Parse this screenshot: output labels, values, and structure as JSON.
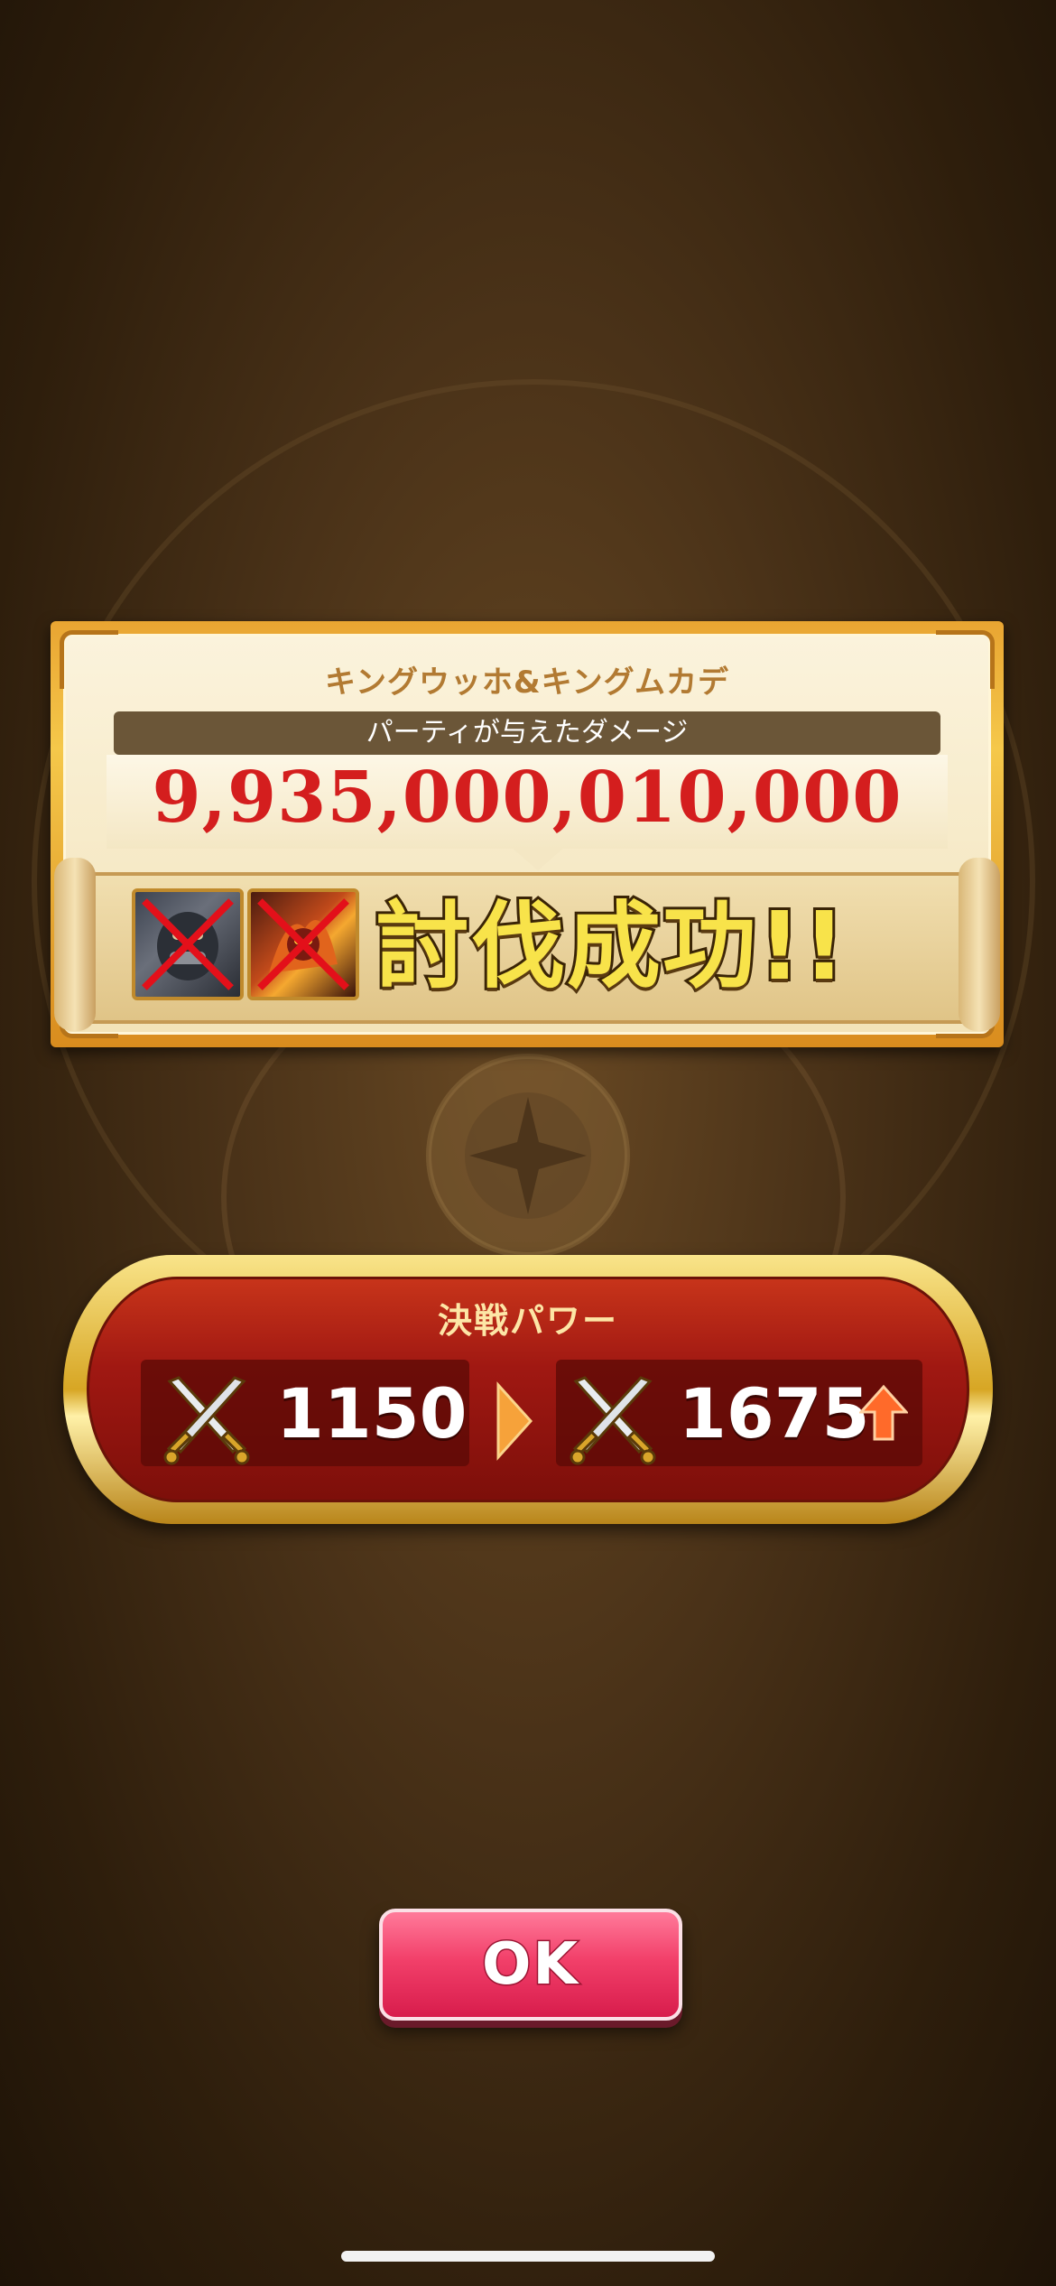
{
  "result_panel": {
    "boss_name": "キングウッホ&キングムカデ",
    "damage_label": "パーティが与えたダメージ",
    "damage_value": "9,935,000,010,000",
    "victory_text": "討伐成功!!",
    "defeated_monsters": [
      "monster-portrait-1",
      "monster-portrait-2"
    ]
  },
  "power_panel": {
    "title": "決戦パワー",
    "before": "1150",
    "after": "1675",
    "icons": {
      "sword": "crossed-swords-icon",
      "arrow": "right-arrow-icon",
      "increase": "up-arrow-icon"
    }
  },
  "ok_button": {
    "label": "OK"
  },
  "colors": {
    "damage": "#d41e1e",
    "victory": "#f8e34a",
    "power_bg": "#a01812",
    "ok_button": "#f2406a"
  }
}
